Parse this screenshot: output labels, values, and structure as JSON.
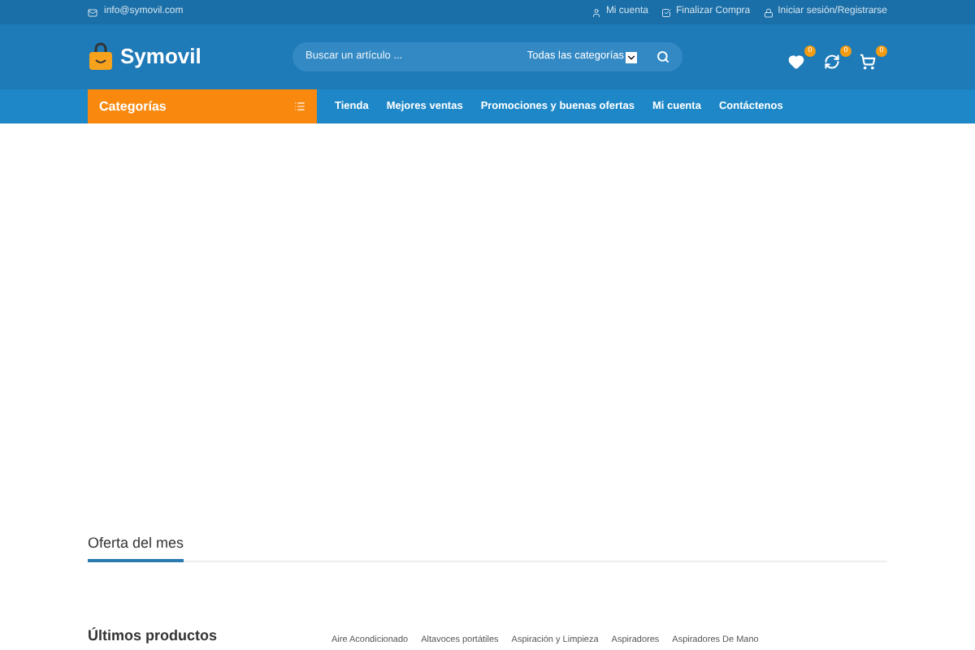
{
  "top_bar": {
    "email": "info@symovil.com",
    "links": [
      {
        "label": "Mi cuenta"
      },
      {
        "label": "Finalizar Compra"
      },
      {
        "label": "Iniciar sesión/Registrarse"
      }
    ]
  },
  "header": {
    "logo": "Symovil",
    "search": {
      "placeholder": "Buscar un artículo ...",
      "category": "Todas las categorías"
    },
    "actions": [
      {
        "count": "0"
      },
      {
        "count": "0"
      },
      {
        "count": "0"
      }
    ]
  },
  "nav": {
    "categories": "Categorías",
    "items": [
      "Tienda",
      "Mejores ventas",
      "Promociones y buenas ofertas",
      "Mi cuenta",
      "Contáctenos"
    ]
  },
  "deal_section": {
    "title": "Oferta del mes"
  },
  "latest_section": {
    "title": "Últimos productos",
    "tabs": [
      "Aire Acondicionado",
      "Altavoces portátiles",
      "Aspiración y Limpieza",
      "Aspiradores",
      "Aspiradores De Mano"
    ]
  }
}
